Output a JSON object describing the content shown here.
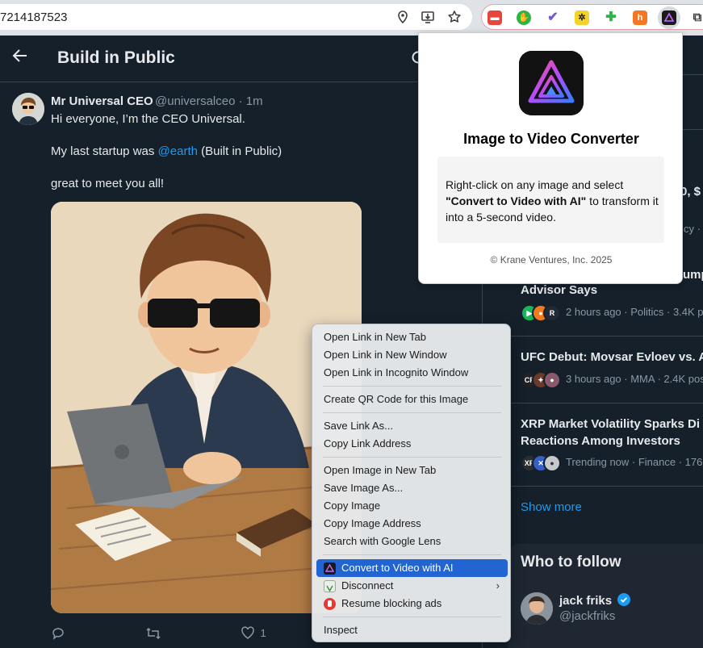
{
  "browser": {
    "url_partial": "7214187523",
    "url_icons": [
      "location-icon",
      "install-app-icon",
      "bookmark-star-icon"
    ],
    "extensions": [
      "shield-extension-icon",
      "thumbs-up-extension-icon",
      "checkmark-extension-icon",
      "sunflower-extension-icon",
      "puzzle-plus-extension-icon",
      "hubspot-extension-icon",
      "krane-extension-icon"
    ]
  },
  "feed": {
    "title": "Build in Public",
    "tweet": {
      "author_name": "Mr Universal CEO",
      "author_handle_time": "@universalceo · 1m",
      "line1": "Hi everyone, I’m the CEO Universal.",
      "line2_prefix": "My last startup was ",
      "line2_mention": "@earth",
      "line2_suffix": " (Built in Public)",
      "line3": "great to meet you all!",
      "like_count": "1"
    }
  },
  "popup": {
    "title": "Image to Video Converter",
    "desc_pre": "Right-click on any image and select ",
    "desc_bold": "\"Convert to Video with AI\"",
    "desc_post": " to transform it into a 5-second video.",
    "footer": "© Krane Ventures, Inc. 2025"
  },
  "context_menu": {
    "items": [
      "Open Link in New Tab",
      "Open Link in New Window",
      "Open Link in Incognito Window",
      "Create QR Code for this Image",
      "Save Link As...",
      "Copy Link Address",
      "Open Image in New Tab",
      "Save Image As...",
      "Copy Image",
      "Copy Image Address",
      "Search with Google Lens",
      "Convert to Video with AI",
      "Disconnect",
      "Resume blocking ads",
      "Inspect"
    ],
    "selected": "Convert to Video with AI"
  },
  "right_column": {
    "partial_top1": "0, $",
    "partial_top2": "cy · (",
    "partial_trend1_line1": "ump",
    "trends": [
      {
        "title": "Advisor Says",
        "meta": "2 hours ago · Politics · 3.4K p"
      },
      {
        "title": "UFC Debut: Movsar Evloev vs. A",
        "meta": "3 hours ago · MMA · 2.4K pos"
      },
      {
        "title": "XRP Market Volatility Sparks Di",
        "title2": "Reactions Among Investors",
        "meta": "Trending now · Finance · 176"
      }
    ],
    "show_more": "Show more",
    "who_to_follow": "Who to follow",
    "follow_name": "jack friks",
    "follow_handle": "@jackfriks"
  }
}
